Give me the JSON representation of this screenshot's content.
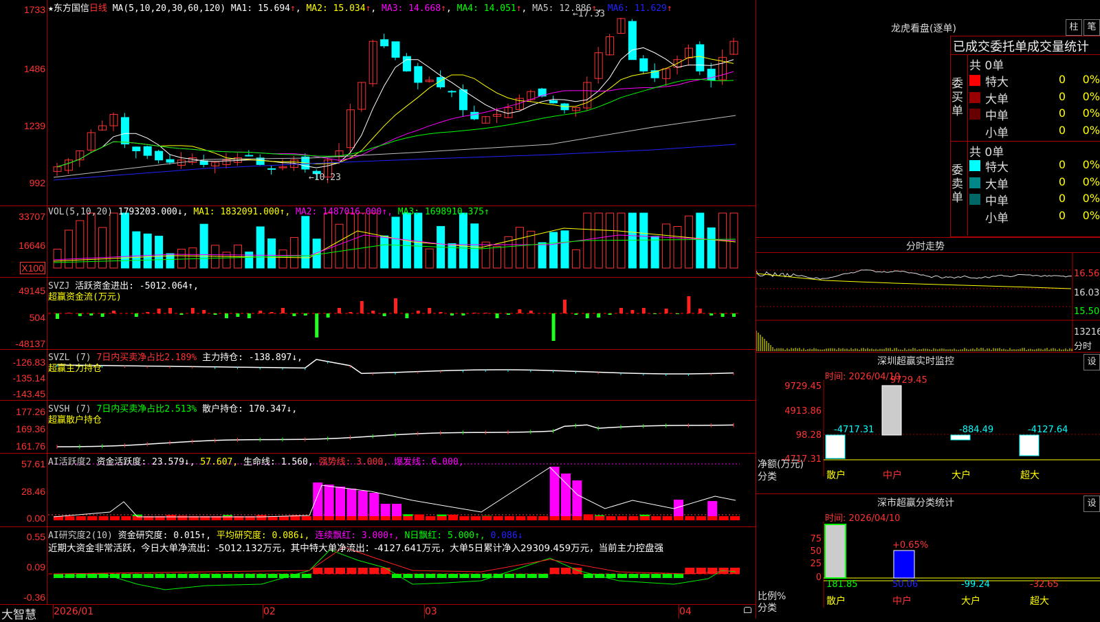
{
  "y_axis": {
    "price": [
      "1733",
      "1486",
      "1239",
      "992"
    ],
    "vol": [
      "33707",
      "16646",
      "X100"
    ],
    "svzj": [
      "49145",
      "504",
      "-48137"
    ],
    "svzl": [
      "-126.83",
      "-135.14",
      "-143.45"
    ],
    "svsh": [
      "177.26",
      "169.36",
      "161.76"
    ],
    "ai1": [
      "57.61",
      "28.46",
      "0.00"
    ],
    "ai2": [
      "0.55",
      "0.09",
      "-0.36"
    ]
  },
  "price_header": {
    "star": "★",
    "stock_name": "东方国信",
    "period": "日线",
    "ma_params": "MA(5,10,20,30,60,120)",
    "ma1": "MA1: 15.694",
    "ma2": "MA2: 15.034",
    "ma3": "MA3: 14.668",
    "ma4": "MA4: 14.051",
    "ma5": "MA5: 12.886",
    "ma6": "MA6: 11.629",
    "up_arrow": "↑",
    "high_annot": "←17.33",
    "low_annot": "←10.23"
  },
  "vol_header": {
    "name": "VOL(5,10,20)",
    "value": "1793203.000↓,",
    "ma1": "MA1: 1832091.000↑,",
    "ma2": "MA2: 1487016.000↑,",
    "ma3": "MA3: 1698910.375↑"
  },
  "svzj_header": {
    "name": "SVZJ",
    "value": "活跃资金进出: -5012.064↑,",
    "label": "超赢资金流(万元)"
  },
  "svzl_header": {
    "name": "SVZL (7)",
    "ratio": "7日内买卖净占比2.189%",
    "value": "主力持仓: -138.897↓,",
    "label": "超赢主力持仓"
  },
  "svsh_header": {
    "name": "SVSH (7)",
    "ratio": "7日内买卖净占比2.513%",
    "value": "散户持仓: 170.347↓,",
    "label": "超赢散户持仓"
  },
  "ai1_header": {
    "name": "AI活跃度2",
    "v1": "资金活跃度: 23.579↓,",
    "v2": "57.607,",
    "v3": "生命线: 1.560,",
    "v4": "强势线: 3.000,",
    "v5": "爆发线: 6.000,"
  },
  "ai2_header": {
    "name": "AI研究度2(10)",
    "v1": "资金研究度: 0.015↑,",
    "v2": "平均研究度: 0.086↓,",
    "v3": "连续飘红: 3.000↑,",
    "v4": "N日飘红: 5.000↑,",
    "v5": "0.086↓",
    "comment": "近期大资金非常活跃，今日大单净流出：-5012.132万元，其中特大单净流出：-4127.641万元，大单5日累计净入29309.459万元，当前主力控盘强"
  },
  "x_axis": {
    "brand": "大智慧",
    "ticks": [
      "2026/01",
      "02",
      "03",
      "04"
    ]
  },
  "lhb": {
    "title": "龙虎看盘(逐单)",
    "btn_zhu": "柱",
    "btn_bi": "笔",
    "subtitle": "已成交委托单成交量统计",
    "buy_side": "委买单",
    "sell_side": "委卖单",
    "buy_total": "共 0单",
    "sell_total": "共 0单",
    "rows_buy": [
      {
        "label": "特大",
        "count": "0",
        "pct": "0%",
        "color": "#ff0000"
      },
      {
        "label": "大单",
        "count": "0",
        "pct": "0%",
        "color": "#990000"
      },
      {
        "label": "中单",
        "count": "0",
        "pct": "0%",
        "color": "#660000"
      },
      {
        "label": "小单",
        "count": "0",
        "pct": "0%",
        "color": "#000000"
      }
    ],
    "rows_sell": [
      {
        "label": "特大",
        "count": "0",
        "pct": "0%",
        "color": "#00ffff"
      },
      {
        "label": "大单",
        "count": "0",
        "pct": "0%",
        "color": "#008888"
      },
      {
        "label": "中单",
        "count": "0",
        "pct": "0%",
        "color": "#006666"
      },
      {
        "label": "小单",
        "count": "0",
        "pct": "0%",
        "color": "#000000"
      }
    ]
  },
  "intraday": {
    "title": "分时走势",
    "price_labels": [
      "16.56",
      "16.03",
      "15.50"
    ],
    "vol_labels": [
      "13216",
      "分时"
    ]
  },
  "monitor": {
    "title": "深圳超赢实时监控",
    "btn": "设",
    "time": "时间: 2026/04/10",
    "y_labels": [
      "9729.45",
      "4913.86",
      "98.28",
      "-4717.31"
    ],
    "values": [
      "-4717.31",
      "9729.45",
      "-884.49",
      "-4127.64"
    ],
    "axis_title": "净额(万元)",
    "axis_sub": "分类",
    "categories": [
      "散户",
      "中户",
      "大户",
      "超大"
    ]
  },
  "classify": {
    "title": "深市超赢分类统计",
    "btn": "设",
    "time": "时间: 2026/04/10",
    "y_labels": [
      "75",
      "50",
      "25",
      "0"
    ],
    "pct_label": "+0.65%",
    "values": [
      "181.85",
      "50.06",
      "-99.24",
      "-32.65"
    ],
    "axis_title": "比例%",
    "axis_sub": "分类",
    "categories": [
      "散户",
      "中户",
      "大户",
      "超大"
    ]
  },
  "colors": {
    "up": "#ff3232",
    "down": "#00ffff",
    "ma1": "#ffffff",
    "ma2": "#ffff00",
    "ma3": "#ff00ff",
    "ma4": "#00ff00",
    "ma5": "#c0c0c0",
    "ma6": "#0000ff",
    "frame": "#aa0000"
  }
}
